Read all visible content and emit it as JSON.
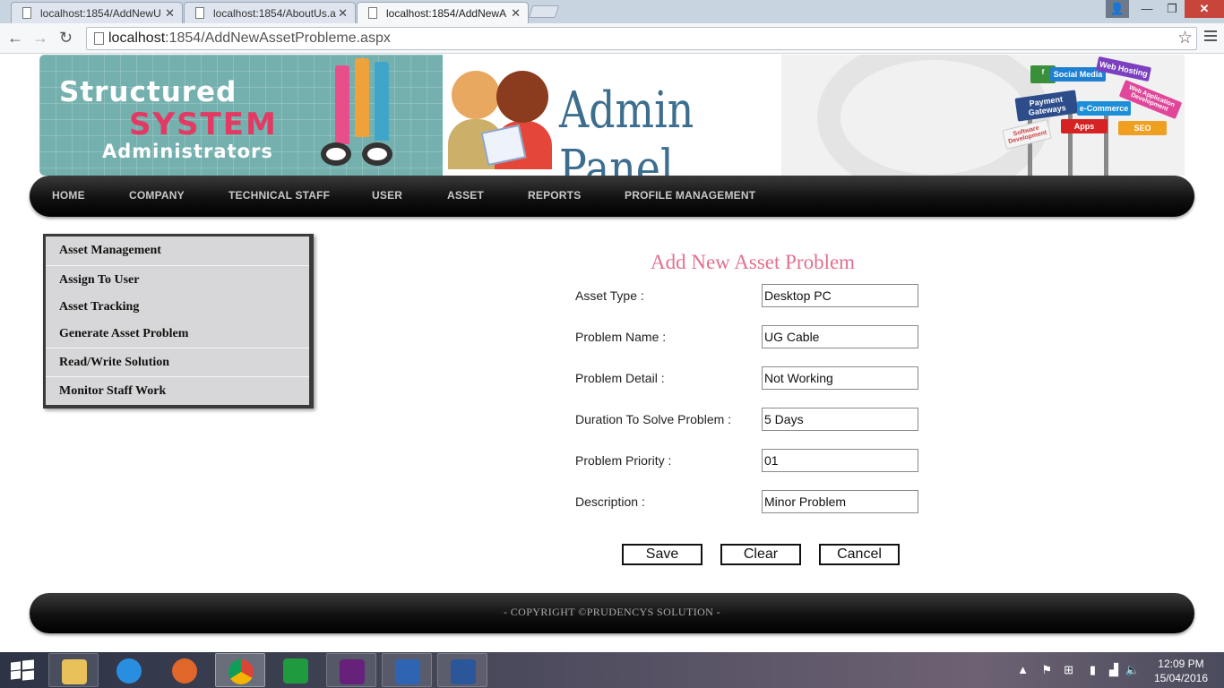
{
  "browser": {
    "tabs": [
      {
        "title": "localhost:1854/AddNewU"
      },
      {
        "title": "localhost:1854/AboutUs.a"
      },
      {
        "title": "localhost:1854/AddNewA"
      }
    ],
    "url_host": "localhost",
    "url_rest": ":1854/AddNewAssetProbleme.aspx"
  },
  "banner": {
    "line1": "Structured",
    "line2": "SYSTEM",
    "line3": "Administrators",
    "panel_title": "Admin Panel",
    "signs": [
      "Social Media",
      "Web Hosting",
      "Payment Gateways",
      "e-Commerce",
      "Web Application Development",
      "Software Development",
      "Apps",
      "SEO"
    ]
  },
  "nav": {
    "items": [
      "HOME",
      "COMPANY",
      "TECHNICAL STAFF",
      "USER",
      "ASSET",
      "REPORTS",
      "PROFILE MANAGEMENT"
    ]
  },
  "sidemenu": {
    "items": [
      "Asset Management",
      "Assign To User",
      "Asset Tracking",
      "Generate Asset Problem",
      "Read/Write Solution",
      "Monitor Staff Work"
    ]
  },
  "form": {
    "title": "Add New Asset Problem",
    "fields": [
      {
        "label": "Asset Type :",
        "value": "Desktop PC"
      },
      {
        "label": "Problem Name :",
        "value": "UG Cable"
      },
      {
        "label": "Problem Detail :",
        "value": "Not Working"
      },
      {
        "label": "Duration To Solve Problem :",
        "value": "5 Days"
      },
      {
        "label": "Problem Priority :",
        "value": "01"
      },
      {
        "label": "Description :",
        "value": "Minor Problem"
      }
    ],
    "buttons": {
      "save": "Save",
      "clear": "Clear",
      "cancel": "Cancel"
    }
  },
  "footer": {
    "copyright": "- COPYRIGHT ©PRUDENCYS SOLUTION -"
  },
  "taskbar": {
    "time": "12:09 PM",
    "date": "15/04/2016",
    "apps": [
      "file-explorer",
      "internet-explorer",
      "firefox",
      "chrome",
      "store",
      "visual-studio",
      "visio",
      "word"
    ]
  }
}
